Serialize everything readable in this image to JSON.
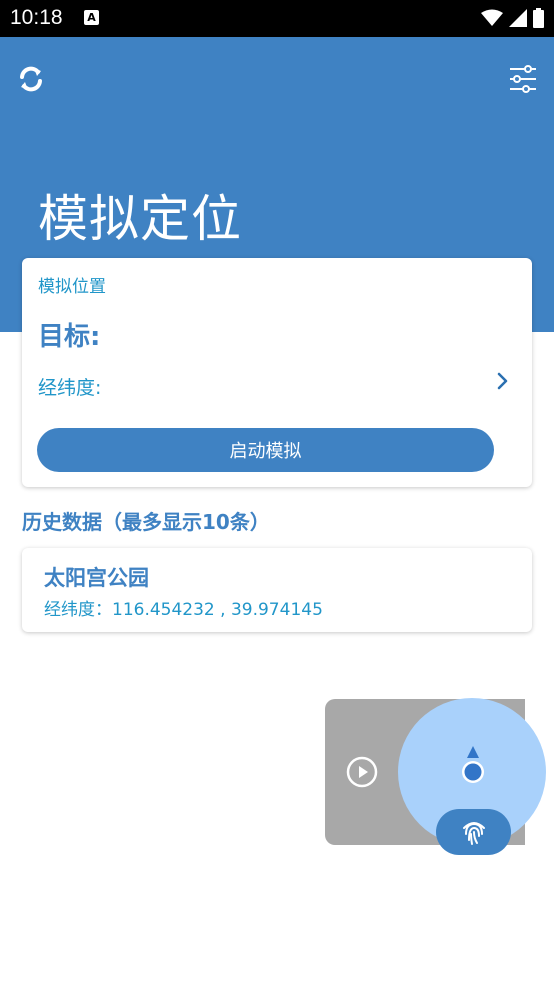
{
  "status_bar": {
    "time": "10:18",
    "notification_badge": "A"
  },
  "header": {
    "title": "模拟定位",
    "refresh_icon": "refresh-icon",
    "settings_icon": "sliders-icon"
  },
  "simulate_card": {
    "section_label": "模拟位置",
    "target_label": "目标:",
    "coordinates_label": "经纬度:",
    "start_button_label": "启动模拟"
  },
  "history": {
    "title": "历史数据（最多显示10条）",
    "items": [
      {
        "name": "太阳宫公园",
        "coordinates": "经纬度：116.454232 , 39.974145"
      }
    ]
  },
  "floating_widget": {
    "play_icon": "play-circle-icon",
    "location_icon": "location-arrow-icon",
    "fingerprint_icon": "fingerprint-icon"
  },
  "colors": {
    "primary": "#3f82c3",
    "accent_text": "#2196c9",
    "float_circle": "#a9d1fb",
    "float_panel": "#a8a8a8"
  }
}
